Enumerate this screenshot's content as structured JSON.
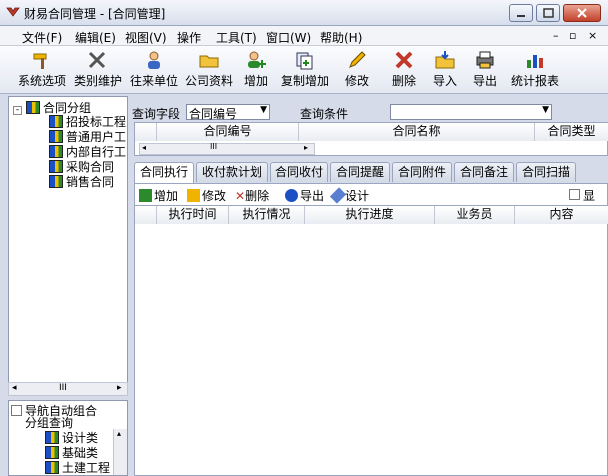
{
  "window": {
    "title": "财易合同管理 - [合同管理]"
  },
  "menu": [
    "文件(F)",
    "编辑(E)",
    "视图(V)",
    "操作",
    "工具(T)",
    "窗口(W)",
    "帮助(H)"
  ],
  "toolbar": [
    {
      "label": "系统选项",
      "icon": "hammer-icon"
    },
    {
      "label": "类别维护",
      "icon": "tools-icon"
    },
    {
      "label": "往来单位",
      "icon": "person-icon"
    },
    {
      "label": "公司资料",
      "icon": "folder-icon"
    },
    {
      "label": "增加",
      "icon": "add-user-icon"
    },
    {
      "label": "复制增加",
      "icon": "copy-add-icon"
    },
    {
      "label": "修改",
      "icon": "pencil-icon"
    },
    {
      "label": "删除",
      "icon": "delete-x-icon"
    },
    {
      "label": "导入",
      "icon": "import-icon"
    },
    {
      "label": "导出",
      "icon": "printer-icon"
    },
    {
      "label": "统计报表",
      "icon": "chart-icon"
    }
  ],
  "tree": {
    "root": "合同分组",
    "children": [
      "招投标工程",
      "普通用户工",
      "内部自行工",
      "采购合同",
      "销售合同"
    ]
  },
  "nav": {
    "checkbox_label": "导航自动组合",
    "label2": "分组查询",
    "items": [
      "设计类",
      "基础类",
      "土建工程"
    ]
  },
  "query": {
    "field_label": "查询字段",
    "field_value": "合同编号",
    "cond_label": "查询条件",
    "cond_value": ""
  },
  "grid_top": {
    "columns": [
      "合同编号",
      "合同名称",
      "合同类型"
    ]
  },
  "tabs": [
    "合同执行",
    "收付款计划",
    "合同收付",
    "合同提醒",
    "合同附件",
    "合同备注",
    "合同扫描"
  ],
  "subtoolbar": [
    "增加",
    "修改",
    "删除",
    "导出",
    "设计"
  ],
  "sub_checkbox": "显",
  "grid_bottom": {
    "columns": [
      "执行时间",
      "执行情况",
      "执行进度",
      "业务员",
      "内容"
    ]
  },
  "scroll_label": "III",
  "colors": {
    "accent": "#3a66c4",
    "close": "#c2412a"
  }
}
